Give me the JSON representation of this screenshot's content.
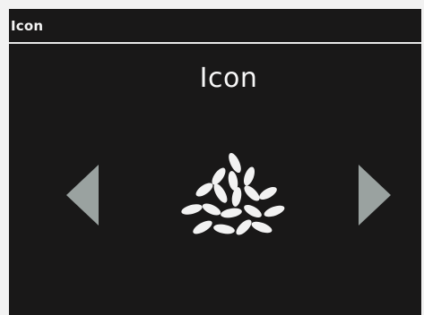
{
  "title_bar": {
    "label": "Icon"
  },
  "screen": {
    "heading": "Icon"
  },
  "preview": {
    "icon": "rice-grains-icon"
  },
  "navigation": {
    "previous_icon": "triangle-left-icon",
    "next_icon": "triangle-right-icon"
  },
  "colors": {
    "background": "#191818",
    "text": "#f4f4f4",
    "arrow": "#9aa2a0"
  }
}
